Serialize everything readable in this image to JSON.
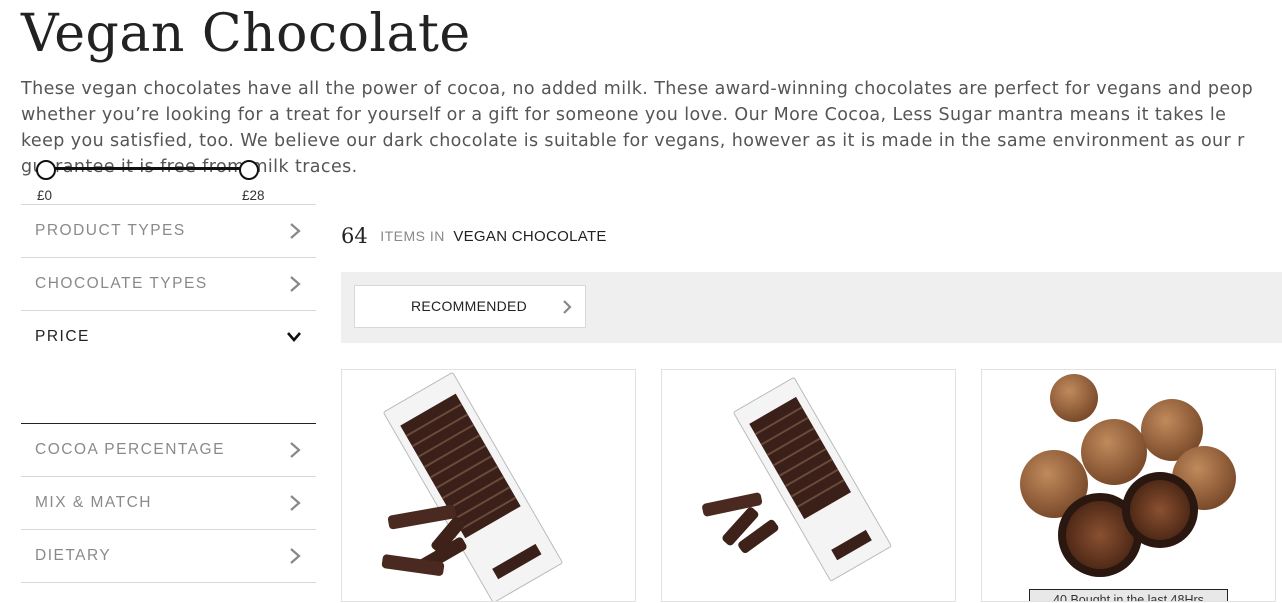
{
  "page": {
    "title": "Vegan Chocolate",
    "intro_lines": [
      "These vegan chocolates have all the power of cocoa, no added milk. These award-winning chocolates are perfect for vegans and peop",
      "whether you’re looking for a treat for yourself or a gift for someone you love. Our More Cocoa, Less Sugar mantra means it takes le",
      "keep you satisfied, too. We believe our dark chocolate is suitable for vegans, however as it is made in the same environment as our r",
      "guarantee it is free from milk traces."
    ]
  },
  "filters": {
    "product_types": "PRODUCT TYPES",
    "chocolate_types": "CHOCOLATE TYPES",
    "price": {
      "label": "PRICE",
      "min_label": "£0",
      "max_label": "£28",
      "min_value": 0,
      "max_value": 28
    },
    "cocoa_percentage": "COCOA PERCENTAGE",
    "mix_match": "MIX & MATCH",
    "dietary": "DIETARY"
  },
  "results": {
    "count": "64",
    "items_in": "ITEMS IN",
    "category": "VEGAN CHOCOLATE"
  },
  "sort": {
    "selected": "RECOMMENDED"
  },
  "products": [
    {
      "image": "batons-chocolate-box-image"
    },
    {
      "image": "batons-chocolate-box-image"
    },
    {
      "image": "cocoa-truffles-image",
      "badge": "40 Bought in the last 48Hrs"
    }
  ],
  "colors": {
    "text_dark": "#222222",
    "text_muted": "#8a8a8a",
    "sort_bar_bg": "#efefef",
    "divider": "#d8d8d8"
  },
  "icons": {
    "filter_row": "chevron-right-icon",
    "price_open": "chevron-down-icon",
    "sort": "chevron-right-icon"
  }
}
